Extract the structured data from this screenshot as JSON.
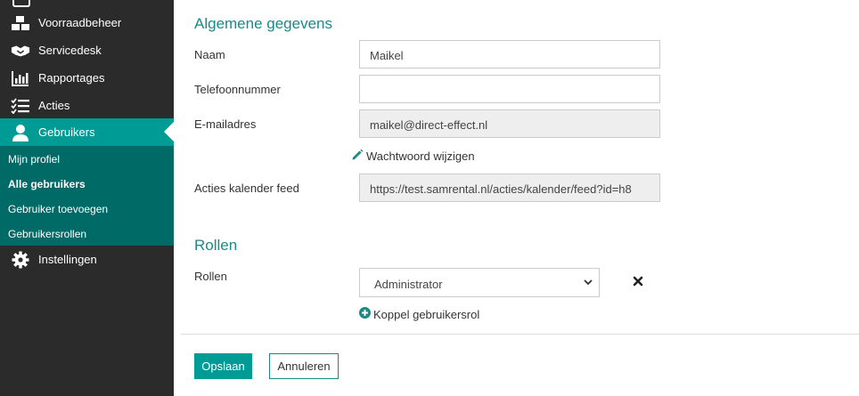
{
  "colors": {
    "accent": "#009b95",
    "submenu_bg": "#006a67",
    "sidebar_bg": "#2b2b2b"
  },
  "sidebar": {
    "items": [
      {
        "label": "Voorraadbeheer",
        "icon": "boxes-icon"
      },
      {
        "label": "Servicedesk",
        "icon": "handshake-icon"
      },
      {
        "label": "Rapportages",
        "icon": "bar-chart-icon"
      },
      {
        "label": "Acties",
        "icon": "checklist-icon"
      },
      {
        "label": "Gebruikers",
        "icon": "user-icon",
        "active": true
      },
      {
        "label": "Instellingen",
        "icon": "gear-icon"
      }
    ],
    "submenu": [
      {
        "label": "Mijn profiel"
      },
      {
        "label": "Alle gebruikers",
        "active": true
      },
      {
        "label": "Gebruiker toevoegen"
      },
      {
        "label": "Gebruikersrollen"
      }
    ]
  },
  "general": {
    "title": "Algemene gegevens",
    "name_label": "Naam",
    "name_value": "Maikel",
    "phone_label": "Telefoonnummer",
    "phone_value": "",
    "email_label": "E-mailadres",
    "email_value": "maikel@direct-effect.nl",
    "change_password": "Wachtwoord wijzigen",
    "calendar_label": "Acties kalender feed",
    "calendar_value": "https://test.samrental.nl/acties/kalender/feed?id=h8"
  },
  "roles": {
    "title": "Rollen",
    "label": "Rollen",
    "selected": "Administrator",
    "add_link": "Koppel gebruikersrol"
  },
  "actions": {
    "save": "Opslaan",
    "cancel": "Annuleren"
  }
}
